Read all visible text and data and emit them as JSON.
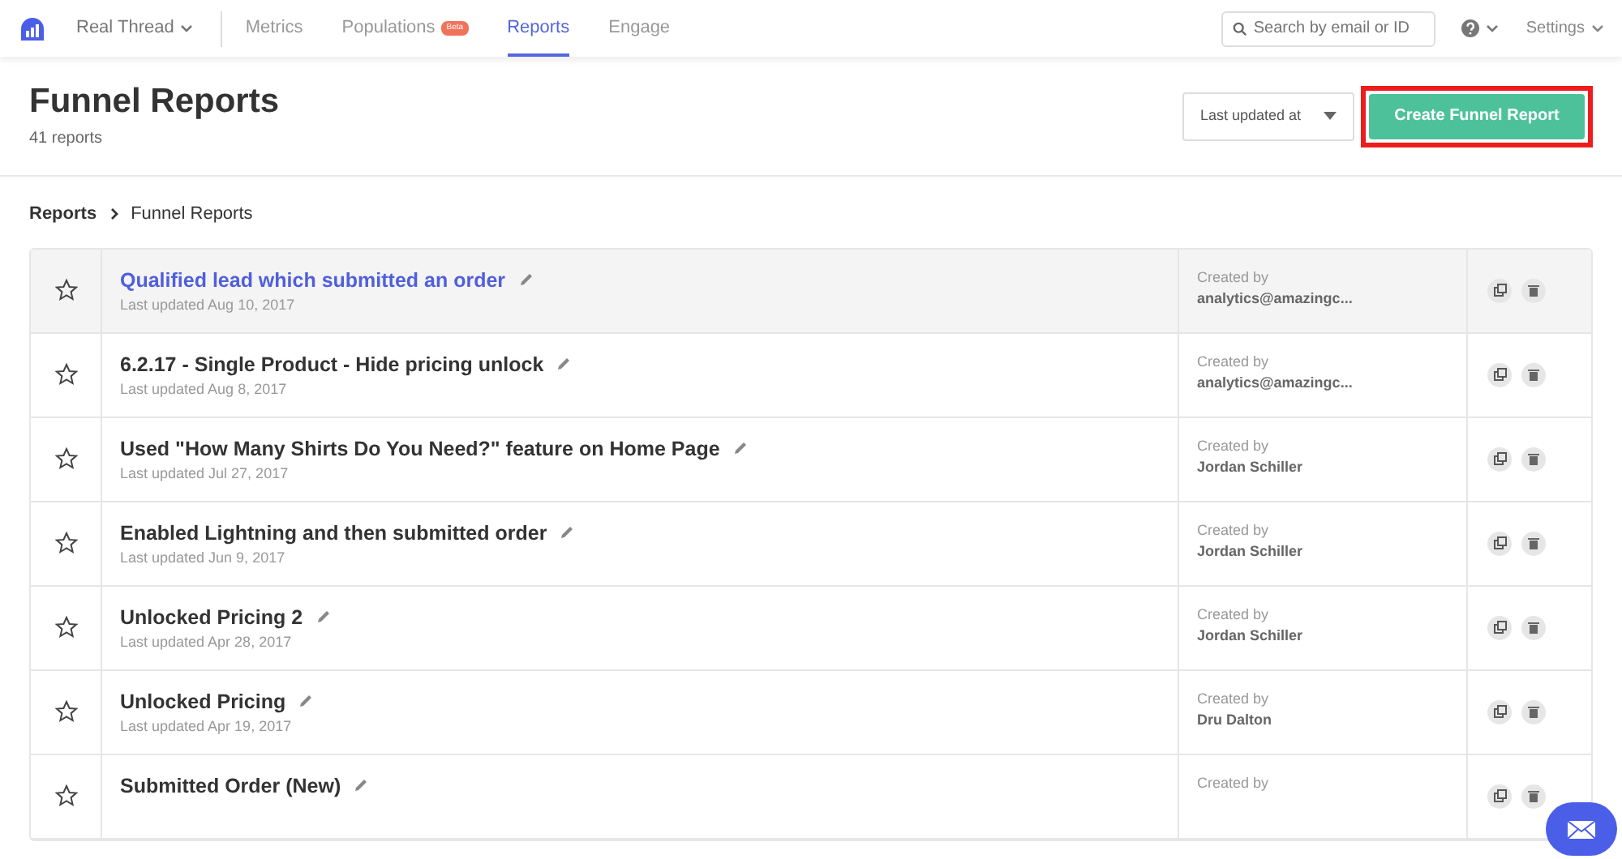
{
  "navbar": {
    "workspace": "Real Thread",
    "items": [
      {
        "label": "Metrics",
        "selected": false
      },
      {
        "label": "Populations",
        "selected": false,
        "badge": "Beta"
      },
      {
        "label": "Reports",
        "selected": true
      },
      {
        "label": "Engage",
        "selected": false
      }
    ],
    "search": {
      "placeholder": "Search by email or ID"
    },
    "settings": "Settings"
  },
  "header": {
    "title": "Funnel Reports",
    "count": "41 reports",
    "sort": "Last updated at",
    "create_button": {
      "label": "Create Funnel Report",
      "highlighted": true
    }
  },
  "breadcrumb": [
    "Reports",
    "Funnel Reports"
  ],
  "reports": [
    {
      "title": "Qualified lead which submitted an order",
      "updated": "Last updated Aug 10, 2017",
      "created_label": "Created by",
      "creator": "analytics@amazingc...",
      "hovered": true,
      "starred": false
    },
    {
      "title": "6.2.17 - Single Product - Hide pricing unlock",
      "updated": "Last updated Aug 8, 2017",
      "created_label": "Created by",
      "creator": "analytics@amazingc...",
      "hovered": false,
      "starred": false
    },
    {
      "title": "Used \"How Many Shirts Do You Need?\" feature on Home Page",
      "updated": "Last updated Jul 27, 2017",
      "created_label": "Created by",
      "creator": "Jordan Schiller",
      "hovered": false,
      "starred": false
    },
    {
      "title": "Enabled Lightning and then submitted order",
      "updated": "Last updated Jun 9, 2017",
      "created_label": "Created by",
      "creator": "Jordan Schiller",
      "hovered": false,
      "starred": false
    },
    {
      "title": "Unlocked Pricing 2",
      "updated": "Last updated Apr 28, 2017",
      "created_label": "Created by",
      "creator": "Jordan Schiller",
      "hovered": false,
      "starred": false
    },
    {
      "title": "Unlocked Pricing",
      "updated": "Last updated Apr 19, 2017",
      "created_label": "Created by",
      "creator": "Dru Dalton",
      "hovered": false,
      "starred": false
    },
    {
      "title": "Submitted Order (New)",
      "created_label": "Created by",
      "hovered": false,
      "starred": false
    }
  ]
}
